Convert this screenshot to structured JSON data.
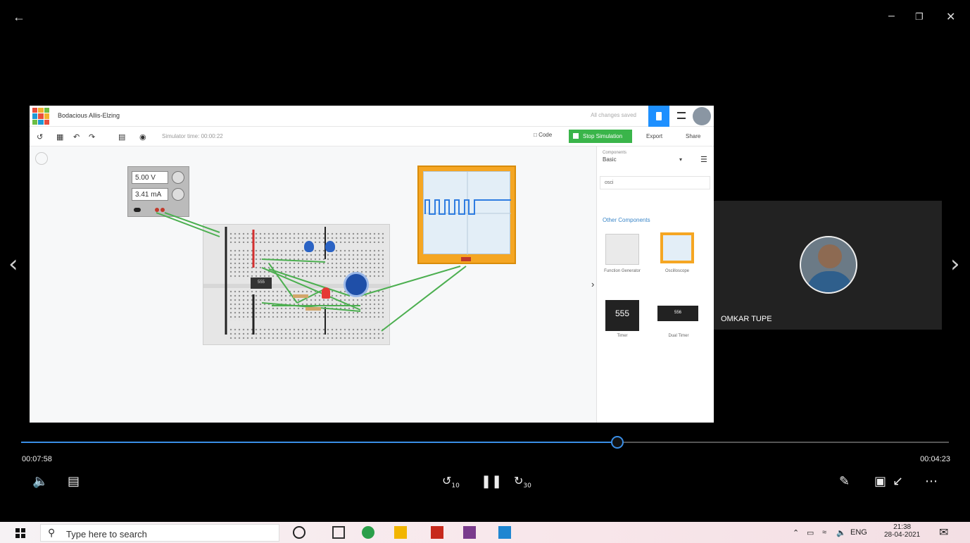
{
  "window": {
    "back_icon": "arrow-left-icon",
    "minimize_icon": "minimize-icon",
    "restore_icon": "restore-icon",
    "close_icon": "close-icon"
  },
  "navigation": {
    "prev_icon": "chevron-left-icon",
    "next_icon": "chevron-right-icon"
  },
  "tinkercad": {
    "design_name": "Bodacious Allis-Elzing",
    "status": "All changes saved",
    "simulator_time": "Simulator time: 00:00:22",
    "code_label": "Code",
    "stop_label": "Stop Simulation",
    "export_label": "Export",
    "share_label": "Share",
    "psu": {
      "voltage": "5.00 V",
      "current": "3.41 mA"
    },
    "chip_label": "555",
    "panel": {
      "components_label": "Components",
      "basic_label": "Basic",
      "search_value": "osci",
      "other_components": "Other Components",
      "items": [
        {
          "name": "Function Generator"
        },
        {
          "name": "Oscilloscope"
        },
        {
          "name": "Timer",
          "chip": "555"
        },
        {
          "name": "Dual Timer",
          "chip": "556"
        }
      ]
    }
  },
  "participant": {
    "name": "OMKAR TUPE"
  },
  "player": {
    "elapsed": "00:07:58",
    "remaining": "00:04:23",
    "progress": 0.643,
    "skip_back": "10",
    "skip_fwd": "30"
  },
  "taskbar": {
    "search_placeholder": "Type here to search",
    "lang": "ENG",
    "time": "21:38",
    "date": "28-04-2021",
    "colors": {
      "accent": "#3a8ee6"
    }
  }
}
